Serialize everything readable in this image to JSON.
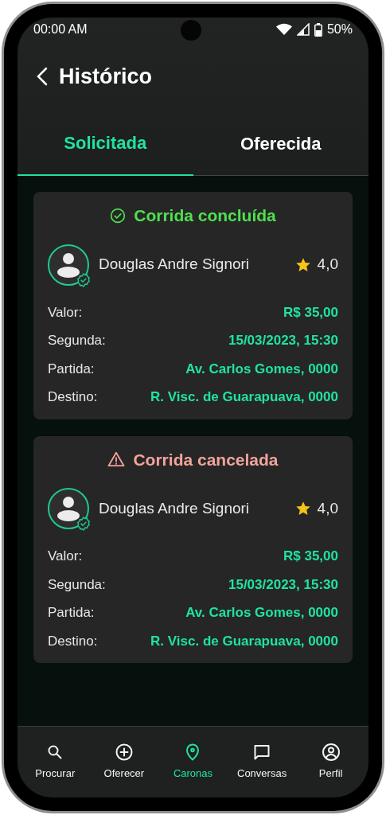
{
  "status_bar": {
    "time": "00:00 AM",
    "battery": "50%"
  },
  "header": {
    "title": "Histórico"
  },
  "tabs": [
    {
      "label": "Solicitada",
      "selected": true
    },
    {
      "label": "Oferecida",
      "selected": false
    }
  ],
  "rides": [
    {
      "status": {
        "kind": "completed",
        "label": "Corrida concluída",
        "color": "#4fe04f"
      },
      "driver": {
        "name": "Douglas Andre Signori",
        "verified": true,
        "rating": "4,0"
      },
      "details": [
        {
          "label": "Valor:",
          "value": "R$ 35,00"
        },
        {
          "label": "Segunda:",
          "value": "15/03/2023, 15:30"
        },
        {
          "label": "Partida:",
          "value": "Av. Carlos Gomes, 0000"
        },
        {
          "label": "Destino:",
          "value": "R. Visc. de Guarapuava, 0000"
        }
      ]
    },
    {
      "status": {
        "kind": "cancelled",
        "label": "Corrida cancelada",
        "color": "#f2a49b"
      },
      "driver": {
        "name": "Douglas Andre Signori",
        "verified": true,
        "rating": "4,0"
      },
      "details": [
        {
          "label": "Valor:",
          "value": "R$ 35,00"
        },
        {
          "label": "Segunda:",
          "value": "15/03/2023, 15:30"
        },
        {
          "label": "Partida:",
          "value": "Av. Carlos Gomes, 0000"
        },
        {
          "label": "Destino:",
          "value": "R. Visc. de Guarapuava, 0000"
        }
      ]
    }
  ],
  "nav": [
    {
      "kind": "search",
      "label": "Procurar",
      "selected": false
    },
    {
      "kind": "add",
      "label": "Oferecer",
      "selected": false
    },
    {
      "kind": "pin",
      "label": "Caronas",
      "selected": true
    },
    {
      "kind": "chat",
      "label": "Conversas",
      "selected": false
    },
    {
      "kind": "profile",
      "label": "Perfil",
      "selected": false
    }
  ]
}
